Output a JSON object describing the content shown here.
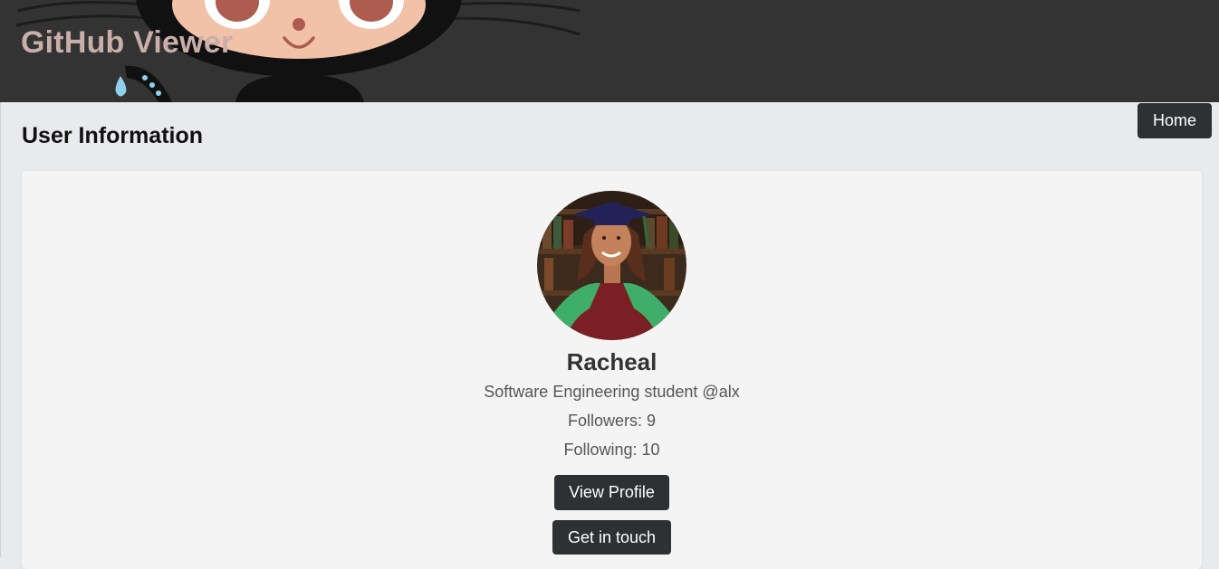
{
  "header": {
    "title": "GitHub Viewer",
    "background_color": "#333333",
    "title_color": "#c9aeaa",
    "art_icon": "octocat-icon"
  },
  "nav": {
    "home_label": "Home"
  },
  "main": {
    "section_title": "User Information"
  },
  "user": {
    "avatar_icon": "avatar-photo",
    "name": "Racheal",
    "bio": "Software Engineering student @alx",
    "followers_label": "Followers: ",
    "followers": "9",
    "following_label": "Following: ",
    "following": "10"
  },
  "actions": {
    "view_profile": "View Profile",
    "get_in_touch": "Get in touch"
  },
  "colors": {
    "button_bg": "#2f3033",
    "page_bg": "#e9eaec",
    "card_bg": "#f4f4f4"
  }
}
